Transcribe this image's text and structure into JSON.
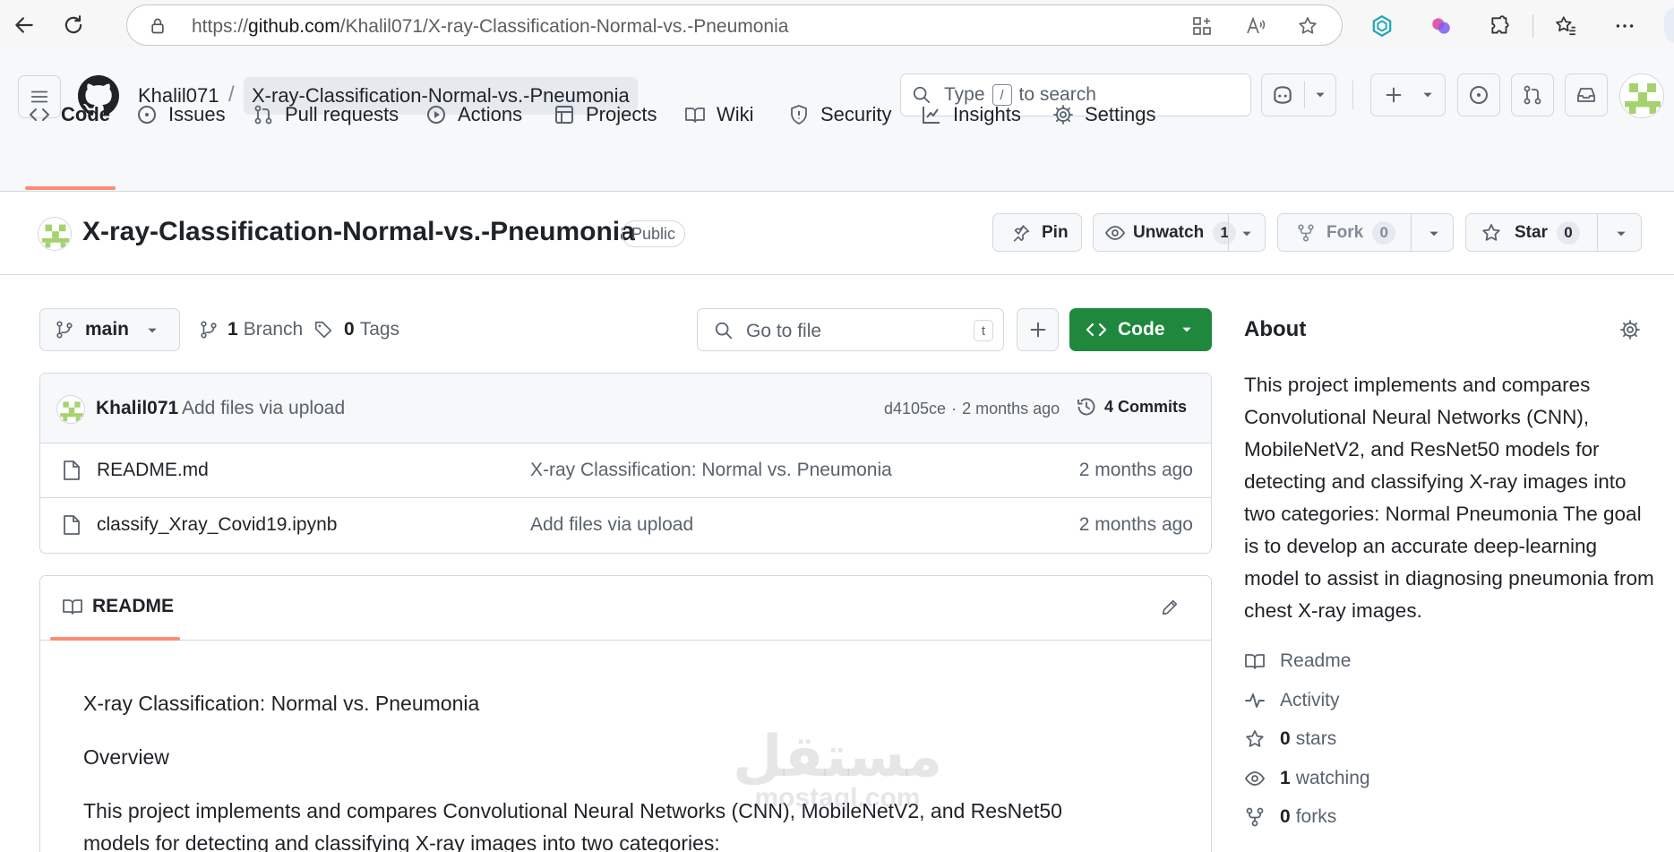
{
  "browser": {
    "url_prefix": "https://",
    "url_host": "github.com",
    "url_path": "/Khalil071/X-ray-Classification-Normal-vs.-Pneumonia"
  },
  "header": {
    "owner": "Khalil071",
    "separator": "/",
    "repo": "X-ray-Classification-Normal-vs.-Pneumonia",
    "search_prefix": "Type",
    "search_key": "/",
    "search_suffix": "to search"
  },
  "tabs": [
    {
      "label": "Code",
      "icon": "code-icon"
    },
    {
      "label": "Issues",
      "icon": "issue-icon"
    },
    {
      "label": "Pull requests",
      "icon": "pull-request-icon"
    },
    {
      "label": "Actions",
      "icon": "play-icon"
    },
    {
      "label": "Projects",
      "icon": "table-icon"
    },
    {
      "label": "Wiki",
      "icon": "book-icon"
    },
    {
      "label": "Security",
      "icon": "shield-icon"
    },
    {
      "label": "Insights",
      "icon": "graph-icon"
    },
    {
      "label": "Settings",
      "icon": "gear-icon"
    }
  ],
  "repo_header": {
    "title": "X-ray-Classification-Normal-vs.-Pneumonia",
    "visibility": "Public",
    "pin_label": "Pin",
    "unwatch_label": "Unwatch",
    "unwatch_count": "1",
    "fork_label": "Fork",
    "fork_count": "0",
    "star_label": "Star",
    "star_count": "0"
  },
  "toolbar": {
    "branch": "main",
    "branch_count": "1",
    "branch_label": "Branch",
    "tag_count": "0",
    "tag_label": "Tags",
    "goto_placeholder": "Go to file",
    "goto_shortcut": "t",
    "code_label": "Code"
  },
  "commit": {
    "author": "Khalil071",
    "message": "Add files via upload",
    "hash": "d4105ce",
    "dot": "·",
    "time": "2 months ago",
    "commits_count": "4",
    "commits_label": "Commits"
  },
  "files": [
    {
      "name": "README.md",
      "message": "X-ray Classification: Normal vs. Pneumonia",
      "time": "2 months ago"
    },
    {
      "name": "classify_Xray_Covid19.ipynb",
      "message": "Add files via upload",
      "time": "2 months ago"
    }
  ],
  "readme": {
    "tab_label": "README",
    "heading": "X-ray Classification: Normal vs. Pneumonia",
    "overview": "Overview",
    "para_line1": "This project implements and compares Convolutional Neural Networks (CNN), MobileNetV2, and ResNet50",
    "para_line2": "models for detecting and classifying X-ray images into two categories:"
  },
  "about": {
    "title": "About",
    "description": "This project implements and compares Convolutional Neural Networks (CNN), MobileNetV2, and ResNet50 models for detecting and classifying X-ray images into two categories: Normal Pneumonia The goal is to develop an accurate deep-learning model to assist in diagnosing pneumonia from chest X-ray images.",
    "readme_label": "Readme",
    "activity_label": "Activity",
    "stars_count": "0",
    "stars_label": "stars",
    "watching_count": "1",
    "watching_label": "watching",
    "forks_count": "0",
    "forks_label": "forks"
  },
  "watermark": {
    "arabic": "مستقل",
    "latin": "mostaql.com"
  },
  "colors": {
    "primary_green": "#1f883d",
    "tab_underline": "#fd8c73",
    "border": "#d1d9e0",
    "muted_text": "#59636e"
  }
}
